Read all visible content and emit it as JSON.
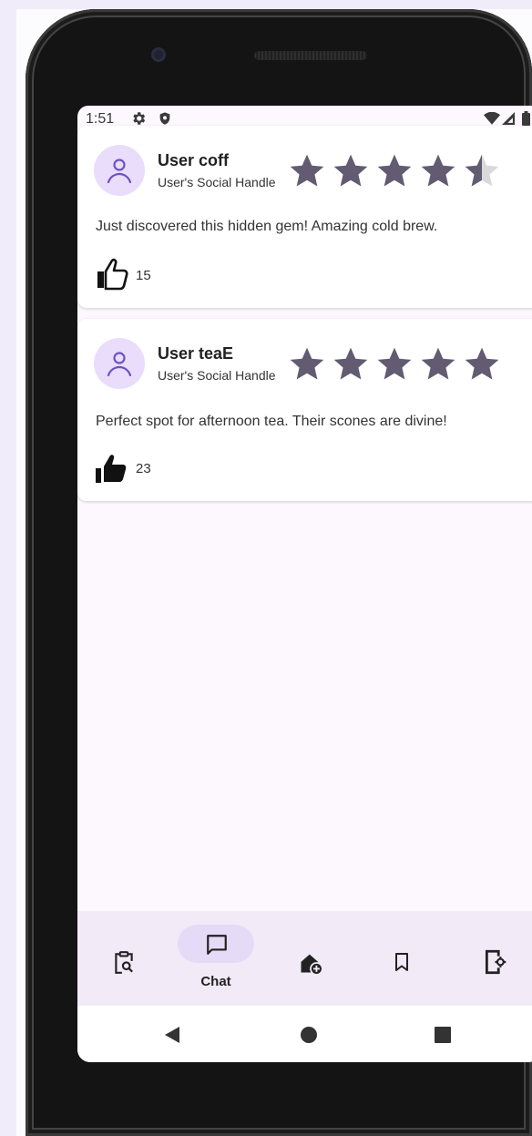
{
  "status_bar": {
    "time": "1:51",
    "icons": [
      "settings-icon",
      "shield-icon",
      "wifi-icon",
      "signal-icon",
      "battery-icon"
    ]
  },
  "reviews": [
    {
      "username": "User coff",
      "handle": "User's Social Handle",
      "rating": 4.5,
      "text": "Just discovered this hidden gem! Amazing cold brew.",
      "likes": "15",
      "liked": false
    },
    {
      "username": "User teaE",
      "handle": "User's Social Handle",
      "rating": 5,
      "text": "Perfect spot for afternoon tea. Their scones are divine!",
      "likes": "23",
      "liked": true
    }
  ],
  "bottom_nav": {
    "items": [
      {
        "icon": "clipboard-search-icon"
      },
      {
        "icon": "chat-icon",
        "label": "Chat",
        "selected": true
      },
      {
        "icon": "add-home-icon"
      },
      {
        "icon": "bookmark-icon"
      },
      {
        "icon": "phone-settings-icon"
      }
    ]
  },
  "system_nav": {
    "icons": [
      "back-icon",
      "home-icon",
      "recents-icon"
    ]
  },
  "colors": {
    "page_background": "#f1ecfa",
    "screen_background": "#fdf8fe",
    "star_filled": "#625b71",
    "star_empty": "#d9d9d9",
    "avatar_background": "#eadcfb",
    "avatar_stroke": "#6b53c0",
    "nav_background": "#f2ebf7",
    "nav_selected_pill": "#e6dbf6"
  }
}
